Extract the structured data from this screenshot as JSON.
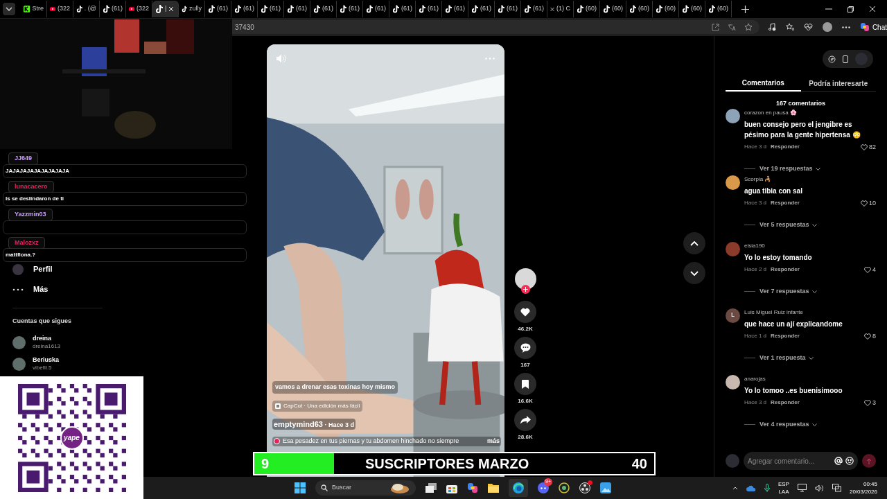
{
  "browser": {
    "tabs": [
      {
        "kind": "kick",
        "label": "Stre",
        "selected": false
      },
      {
        "kind": "youtube",
        "label": "(322",
        "selected": false
      },
      {
        "kind": "tiktok",
        "label": ". (@",
        "selected": false
      },
      {
        "kind": "tiktok",
        "label": "(61)",
        "selected": false
      },
      {
        "kind": "youtube",
        "label": "(322",
        "selected": false
      },
      {
        "kind": "tiktok",
        "label": "|",
        "selected": true
      },
      {
        "kind": "tiktok",
        "label": "zully",
        "selected": false
      },
      {
        "kind": "tiktok",
        "label": "(61)",
        "selected": false
      },
      {
        "kind": "tiktok",
        "label": "(61)",
        "selected": false
      },
      {
        "kind": "tiktok",
        "label": "(61)",
        "selected": false
      },
      {
        "kind": "tiktok",
        "label": "(61)",
        "selected": false
      },
      {
        "kind": "tiktok",
        "label": "(61)",
        "selected": false
      },
      {
        "kind": "tiktok",
        "label": "(61)",
        "selected": false
      },
      {
        "kind": "tiktok",
        "label": "(61)",
        "selected": false
      },
      {
        "kind": "tiktok",
        "label": "(61)",
        "selected": false
      },
      {
        "kind": "tiktok",
        "label": "(61)",
        "selected": false
      },
      {
        "kind": "tiktok",
        "label": "(61)",
        "selected": false
      },
      {
        "kind": "tiktok",
        "label": "(61)",
        "selected": false
      },
      {
        "kind": "tiktok",
        "label": "(61)",
        "selected": false
      },
      {
        "kind": "tiktok",
        "label": "(61)",
        "selected": false
      },
      {
        "kind": "x",
        "label": "(1) C",
        "selected": false
      },
      {
        "kind": "tiktok",
        "label": "(60)",
        "selected": false
      },
      {
        "kind": "tiktok",
        "label": "(60)",
        "selected": false
      },
      {
        "kind": "tiktok",
        "label": "(60)",
        "selected": false
      },
      {
        "kind": "tiktok",
        "label": "(60)",
        "selected": false
      },
      {
        "kind": "tiktok",
        "label": "(60)",
        "selected": false
      },
      {
        "kind": "tiktok",
        "label": "(60)",
        "selected": false
      }
    ],
    "address": "37430",
    "chat_button": "Chat"
  },
  "sidebar": {
    "items": [
      {
        "label": "Perfil",
        "kind": "profile"
      },
      {
        "label": "Más",
        "kind": "more"
      }
    ],
    "following_title": "Cuentas que sigues",
    "following": [
      {
        "name": "dreina",
        "handle": "dreina1613"
      },
      {
        "name": "Beriuska",
        "handle": "vibefit.5"
      }
    ]
  },
  "stream_chat": [
    {
      "user": "JJ649",
      "color": "#c9a0ff",
      "message": "JAJAJAJAJAJAJAJAJA"
    },
    {
      "user": "lunacacero",
      "color": "#e0245e",
      "message": "Is se deslindaron de ti"
    },
    {
      "user": "Yazzmin03",
      "color": "#c9a0ff"
    },
    {
      "user": "Malozxz",
      "color": "#e0245e",
      "message": "mattfiona.?"
    }
  ],
  "video": {
    "caption": "vamos a drenar esas toxinas hoy mismo",
    "app_tag": "CapCut · Una edición más fácil",
    "author": "emptymind63",
    "age": " · Hace 3 d",
    "description": "Esa pesadez en tus piernas y tu abdomen hinchado no siempre",
    "more": "más",
    "actions": [
      {
        "kind": "like",
        "count": "46.2K"
      },
      {
        "kind": "comment",
        "count": "167"
      },
      {
        "kind": "save",
        "count": "16.6K"
      },
      {
        "kind": "share",
        "count": "28.6K"
      }
    ]
  },
  "comments_panel": {
    "tabs": [
      {
        "label": "Comentarios",
        "selected": true
      },
      {
        "label": "Podría interesarte",
        "selected": false
      }
    ],
    "count": "167 comentarios",
    "comments": [
      {
        "user": "corazon en pausa 🌸",
        "text": "buen consejo pero el jengibre es pésimo para la gente hipertensa 😳",
        "time": "Hace 3 d",
        "reply": "Responder",
        "likes": "82",
        "replies": "Ver 19 respuestas",
        "color": "#8fa3b8"
      },
      {
        "user": "Scorpia 🦂",
        "text": "agua tibia con sal",
        "time": "Hace 3 d",
        "reply": "Responder",
        "likes": "10",
        "replies": "Ver 5 respuestas",
        "color": "#d89a4a"
      },
      {
        "user": "elsia190",
        "text": "Yo lo estoy tomando",
        "time": "Hace 2 d",
        "reply": "Responder",
        "likes": "4",
        "replies": "Ver 7 respuestas",
        "color": "#8a3b2a"
      },
      {
        "user": "Luis Miguel Ruiz infante",
        "letter": "L",
        "text": "que hace un ají explicandome",
        "time": "Hace 1 d",
        "reply": "Responder",
        "likes": "8",
        "replies": "Ver 1 respuesta",
        "color": "#6b4a44"
      },
      {
        "user": "anarojas",
        "text": "Yo lo tomoo ..es buenisimooo",
        "time": "Hace 3 d",
        "reply": "Responder",
        "likes": "3",
        "replies": "Ver 4 respuestas",
        "color": "#c8b8b0"
      }
    ],
    "input_placeholder": "Agregar comentario..."
  },
  "subs_goal": {
    "current": "9",
    "title": "SUSCRIPTORES MARZO",
    "target": "40",
    "level": 0.2
  },
  "qr": {
    "brand": "yape"
  },
  "taskbar": {
    "search_placeholder": "Buscar",
    "discord_badge": "9+",
    "language": "ESP",
    "layout": "LAA",
    "time": "00:45",
    "date": "20/03/2026"
  }
}
